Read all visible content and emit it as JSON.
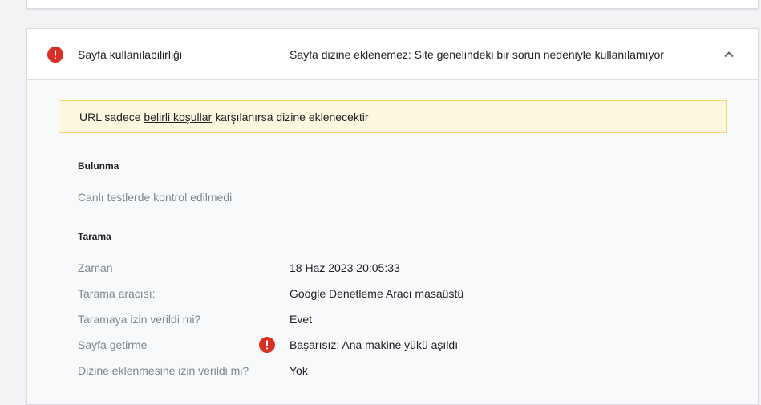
{
  "header": {
    "title": "Sayfa kullanılabilirliği",
    "status": "Sayfa dizine eklenemez: Site genelindeki bir sorun nedeniyle kullanılamıyor"
  },
  "notice": {
    "prefix": "URL sadece ",
    "link": "belirli koşullar",
    "suffix": " karşılanırsa dizine eklenecektir"
  },
  "discovery": {
    "title": "Bulunma",
    "text": "Canlı testlerde kontrol edilmedi"
  },
  "crawl": {
    "title": "Tarama",
    "rows": [
      {
        "label": "Zaman",
        "value": "18 Haz 2023 20:05:33"
      },
      {
        "label": "Tarama aracısı:",
        "value": "Google Denetleme Aracı masaüstü"
      },
      {
        "label": "Taramaya izin verildi mi?",
        "value": "Evet"
      },
      {
        "label": "Sayfa getirme",
        "value": "Başarısız: Ana makine yükü aşıldı"
      },
      {
        "label": "Dizine eklenmesine izin verildi mi?",
        "value": "Yok"
      }
    ]
  },
  "colors": {
    "error": "#d93025",
    "notice_bg": "#fef7e0",
    "notice_border": "#f9d466"
  },
  "icons": {
    "header": "error-icon",
    "fetch": "error-icon",
    "collapse": "chevron-up-icon"
  }
}
